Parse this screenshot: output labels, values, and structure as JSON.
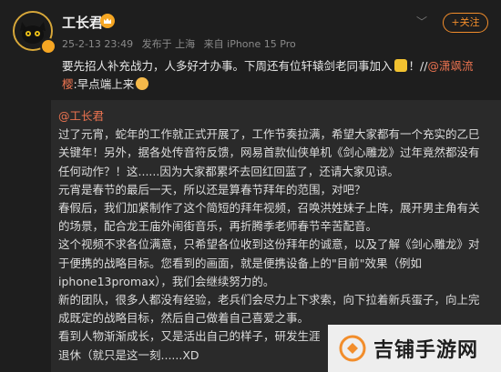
{
  "post": {
    "username": "工长君",
    "timestamp": "25-2-13 23:49",
    "source": "发布于 上海",
    "device": "来自 iPhone 15 Pro",
    "follow_label": "+关注",
    "chevron": "﹀",
    "text_before": "要先招人补充战力，人多好才办事。下周还有位轩辕剑老同事加入",
    "text_mid": "！//",
    "mention": "@潇飒流樱",
    "text_after": ":早点端上来"
  },
  "repost": {
    "username": "@工长君",
    "paragraphs": [
      "过了元宵，蛇年的工作就正式开展了，工作节奏拉满，希望大家都有一个充实的乙巳关键年！另外，据各处传音符反馈，网易首款仙侠单机《剑心雕龙》过年竟然都没有任何动作？！这......因为大家都累坏去回红回蓝了，还请大家见谅。",
      "元宵是春节的最后一天，所以还是算春节拜年的范围，对吧？",
      "春假后，我们加紧制作了这个简短的拜年视频，召唤洪姓妹子上阵，展开男主角有关的场景，配合龙王庙外闹街音乐，再折腾季老师春节辛苦配音。",
      "这个视频不求各位满意，只希望各位收到这份拜年的诚意，以及了解《剑心雕龙》对于便携的战略目标。您看到的画面，就是便携设备上的\"目前\"效果（例如iphone13promax），我们会继续努力的。",
      "新的团队，很多人都没有经验，老兵们会尽力上下求索，向下拉着新兵蛋子，向上完成既定的战略目标，然后自己做着自己喜爱之事。",
      "看到人物渐渐成长，又是活出自己的样子，研发生涯",
      "退休（就只是这一刻......XD"
    ]
  },
  "watermark": {
    "text": "吉铺手游网"
  },
  "colors": {
    "accent": "#f28d2b",
    "link": "#eb7350",
    "background": "#1e1e1e",
    "repost_bg": "#2a2a2a"
  }
}
